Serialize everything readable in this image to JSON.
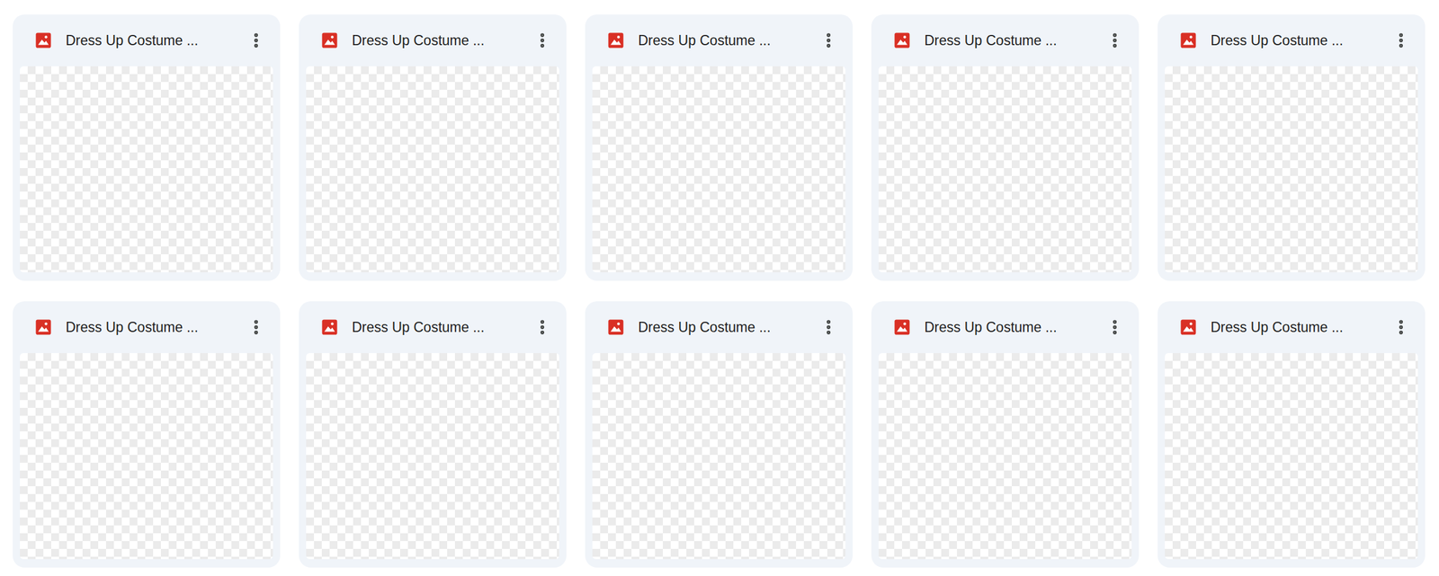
{
  "files": [
    {
      "name": "Dress Up Costume ..."
    },
    {
      "name": "Dress Up Costume ..."
    },
    {
      "name": "Dress Up Costume ..."
    },
    {
      "name": "Dress Up Costume ..."
    },
    {
      "name": "Dress Up Costume ..."
    },
    {
      "name": "Dress Up Costume ..."
    },
    {
      "name": "Dress Up Costume ..."
    },
    {
      "name": "Dress Up Costume ..."
    },
    {
      "name": "Dress Up Costume ..."
    },
    {
      "name": "Dress Up Costume ..."
    }
  ]
}
